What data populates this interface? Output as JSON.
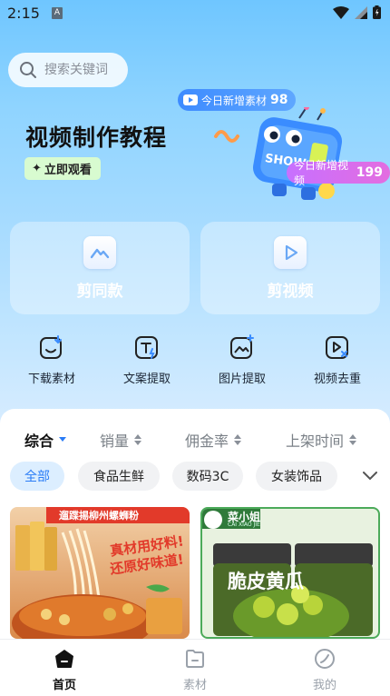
{
  "status": {
    "time": "2:15",
    "notif": "A"
  },
  "search": {
    "placeholder": "搜索关键词"
  },
  "banner": {
    "title": "视频制作教程",
    "button": "立即观看",
    "new_materials_label": "今日新增素材",
    "new_materials_count": "98",
    "new_videos_label": "今日新增视频",
    "new_videos_count": "199",
    "mascot_text": "SHOW"
  },
  "cards": [
    {
      "label": "剪同款",
      "icon": "mountain-icon"
    },
    {
      "label": "剪视频",
      "icon": "play-icon"
    }
  ],
  "tools": [
    {
      "label": "下载素材",
      "icon": "download-smile-icon"
    },
    {
      "label": "文案提取",
      "icon": "text-extract-icon"
    },
    {
      "label": "图片提取",
      "icon": "image-extract-icon"
    },
    {
      "label": "视频去重",
      "icon": "video-dedupe-icon"
    }
  ],
  "sorts": [
    {
      "label": "综合",
      "active": true
    },
    {
      "label": "销量"
    },
    {
      "label": "佣金率"
    },
    {
      "label": "上架时间"
    }
  ],
  "categories": [
    "全部",
    "食品生鲜",
    "数码3C",
    "女装饰品"
  ],
  "products": [
    {
      "banner": "遛蹀掦柳州螺蛳粉",
      "tag1": "真材用好料!",
      "tag2": "还原好味道!"
    },
    {
      "brand": "菜小姐",
      "brand_en": "CAI XIAO JIE",
      "name": "脆皮黄瓜"
    }
  ],
  "nav": [
    {
      "label": "首页",
      "active": true
    },
    {
      "label": "素材"
    },
    {
      "label": "我的"
    }
  ],
  "colors": {
    "accent": "#2a7cf6",
    "pill_blue": "#3d8bff",
    "pill_pink": "#d96be8",
    "cta_bg": "#d8fbd0"
  }
}
